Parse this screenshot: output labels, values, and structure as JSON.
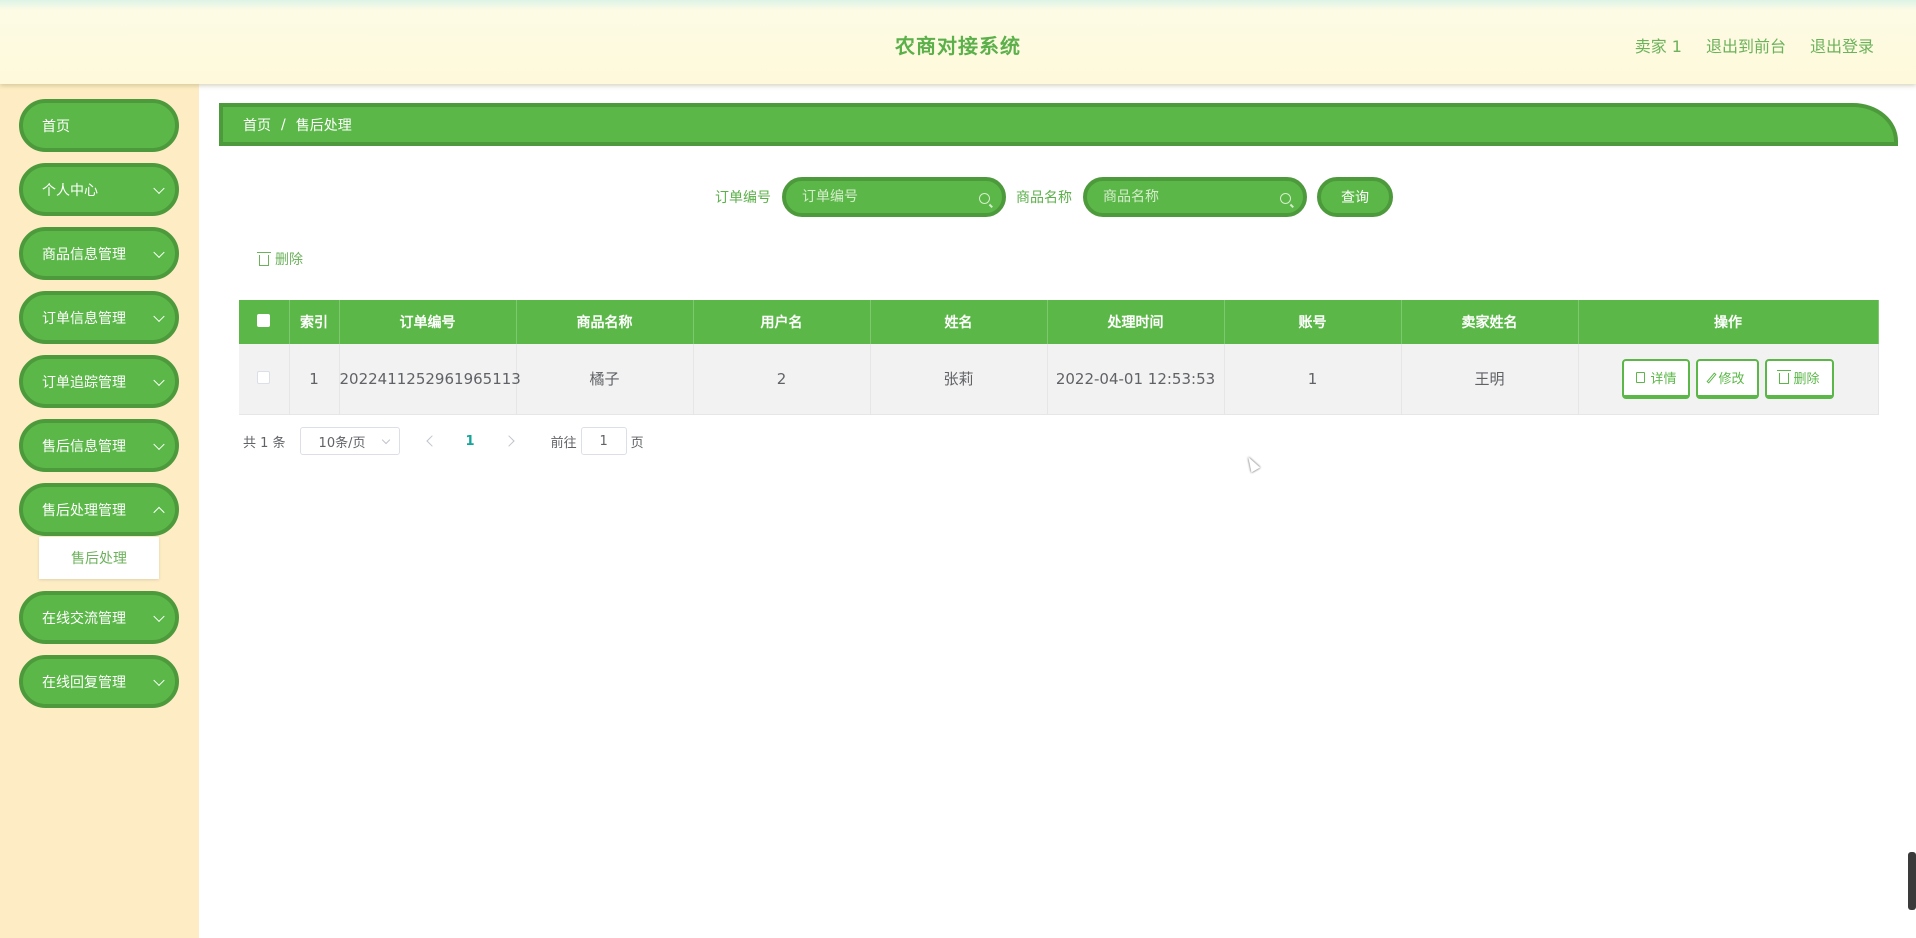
{
  "header": {
    "title": "农商对接系统",
    "user": "卖家 1",
    "to_front": "退出到前台",
    "logout": "退出登录"
  },
  "sidebar": {
    "items": [
      {
        "label": "首页"
      },
      {
        "label": "个人中心"
      },
      {
        "label": "商品信息管理"
      },
      {
        "label": "订单信息管理"
      },
      {
        "label": "订单追踪管理"
      },
      {
        "label": "售后信息管理"
      },
      {
        "label": "售后处理管理"
      },
      {
        "label": "在线交流管理"
      },
      {
        "label": "在线回复管理"
      }
    ],
    "submenu": {
      "label": "售后处理"
    }
  },
  "breadcrumb": {
    "home": "首页",
    "separator": "/",
    "current": "售后处理"
  },
  "search": {
    "order_label": "订单编号",
    "order_placeholder": "订单编号",
    "product_label": "商品名称",
    "product_placeholder": "商品名称",
    "query_label": "查询"
  },
  "toolbar": {
    "delete_label": "删除"
  },
  "table": {
    "headers": [
      "索引",
      "订单编号",
      "商品名称",
      "用户名",
      "姓名",
      "处理时间",
      "账号",
      "卖家姓名",
      "操作"
    ],
    "rows": [
      {
        "index": "1",
        "order_no": "2022411252961965113",
        "product": "橘子",
        "username": "2",
        "name": "张莉",
        "time": "2022-04-01 12:53:53",
        "account": "1",
        "seller": "王明"
      }
    ],
    "actions": {
      "detail": "详情",
      "edit": "修改",
      "delete": "删除"
    }
  },
  "pagination": {
    "total": "共 1 条",
    "page_size": "10条/页",
    "current_page": "1",
    "goto_label": "前往",
    "goto_value": "1",
    "page_suffix": "页"
  },
  "colors": {
    "accent": "#5bb848",
    "accent_dark": "#4d9a3c",
    "sidebar_bg": "#feedc4",
    "header_bg": "#fef9db"
  }
}
